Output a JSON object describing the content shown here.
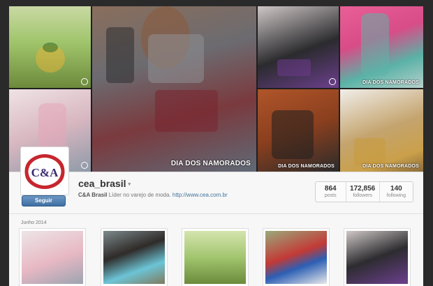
{
  "cover": {
    "watermark_small": "DIA DOS NAMORADOS",
    "watermark_large": "DIA DOS NAMORADOS"
  },
  "profile": {
    "logo_text": "C&A",
    "follow_label": "Seguir",
    "username": "cea_brasil",
    "bio_name": "C&A Brasil",
    "bio_text": "Líder no varejo de moda.",
    "bio_link": "http://www.cea.com.br"
  },
  "stats": [
    {
      "value": "864",
      "label": "posts"
    },
    {
      "value": "172,856",
      "label": "followers"
    },
    {
      "value": "140",
      "label": "following"
    }
  ],
  "feed": {
    "month_label": "Junho 2014"
  },
  "colors": {
    "brand_red": "#c6262e",
    "follow_blue": "#3f6fa3",
    "link_blue": "#3f729b"
  }
}
